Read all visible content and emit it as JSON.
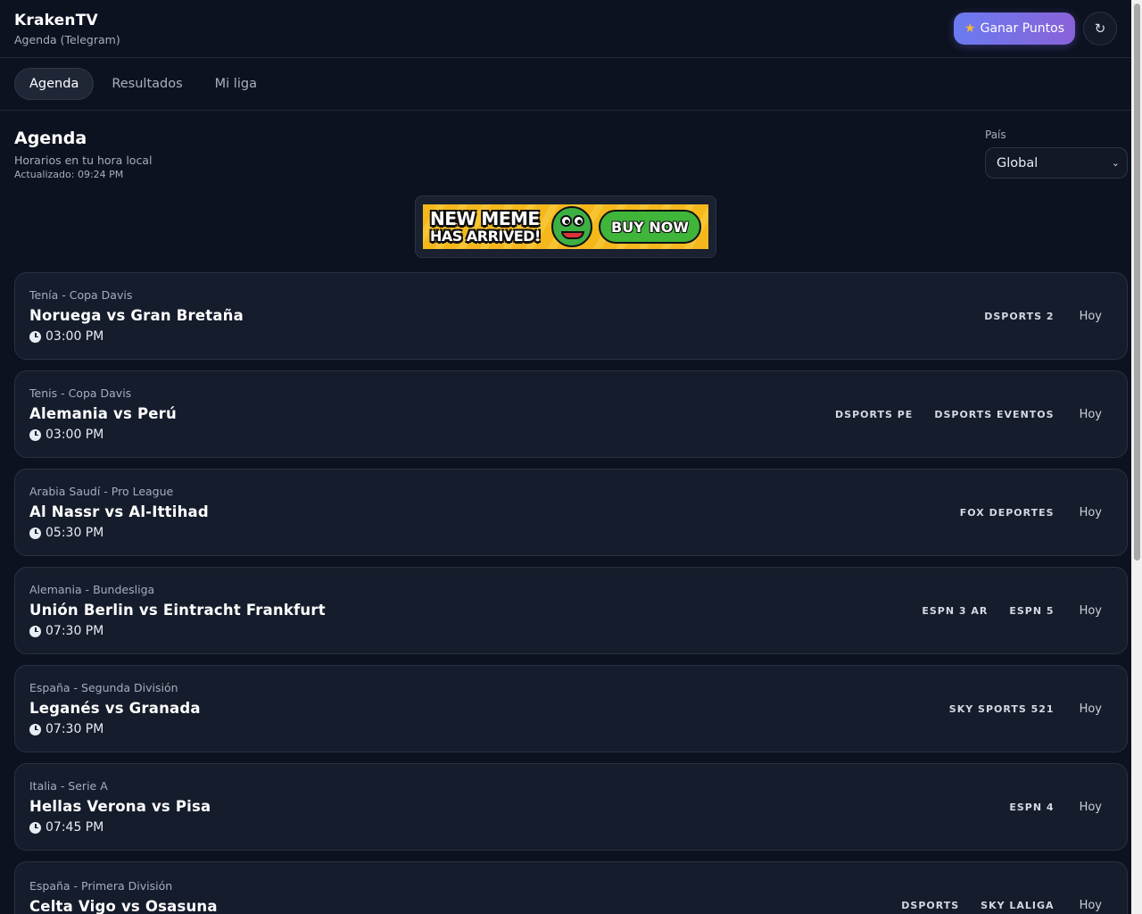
{
  "header": {
    "title": "KrakenTV",
    "subtitle": "Agenda (Telegram)",
    "points_label": "Ganar Puntos",
    "star_glyph": "★",
    "refresh_glyph": "↻"
  },
  "tabs": [
    {
      "label": "Agenda",
      "active": true
    },
    {
      "label": "Resultados",
      "active": false
    },
    {
      "label": "Mi liga",
      "active": false
    }
  ],
  "section": {
    "title": "Agenda",
    "subtitle": "Horarios en tu hora local",
    "updated": "Actualizado: 09:24 PM"
  },
  "country": {
    "label": "País",
    "selected": "Global",
    "chevron_glyph": "⌄"
  },
  "banner": {
    "line1": "NEW MEME",
    "line2": "HAS ARRIVED!",
    "button": "BUY NOW"
  },
  "events": [
    {
      "league": "Tenía - Copa Davis",
      "title": "Noruega vs Gran Bretaña",
      "time": "03:00 PM",
      "channels": [
        "DSPORTS 2"
      ],
      "day": "Hoy"
    },
    {
      "league": "Tenis - Copa Davis",
      "title": "Alemania vs Perú",
      "time": "03:00 PM",
      "channels": [
        "DSPORTS PE",
        "DSPORTS EVENTOS"
      ],
      "day": "Hoy"
    },
    {
      "league": "Arabia Saudí - Pro League",
      "title": "Al Nassr vs Al-Ittihad",
      "time": "05:30 PM",
      "channels": [
        "FOX DEPORTES"
      ],
      "day": "Hoy"
    },
    {
      "league": "Alemania - Bundesliga",
      "title": "Unión Berlin vs Eintracht Frankfurt",
      "time": "07:30 PM",
      "channels": [
        "ESPN 3 AR",
        "ESPN 5"
      ],
      "day": "Hoy"
    },
    {
      "league": "España - Segunda División",
      "title": "Leganés vs Granada",
      "time": "07:30 PM",
      "channels": [
        "SKY SPORTS 521"
      ],
      "day": "Hoy"
    },
    {
      "league": "Italia - Serie A",
      "title": "Hellas Verona vs Pisa",
      "time": "07:45 PM",
      "channels": [
        "ESPN 4"
      ],
      "day": "Hoy"
    },
    {
      "league": "España - Primera División",
      "title": "Celta Vigo vs Osasuna",
      "time": "",
      "channels": [
        "DSPORTS",
        "SKY LALIGA"
      ],
      "day": "Hoy"
    }
  ]
}
